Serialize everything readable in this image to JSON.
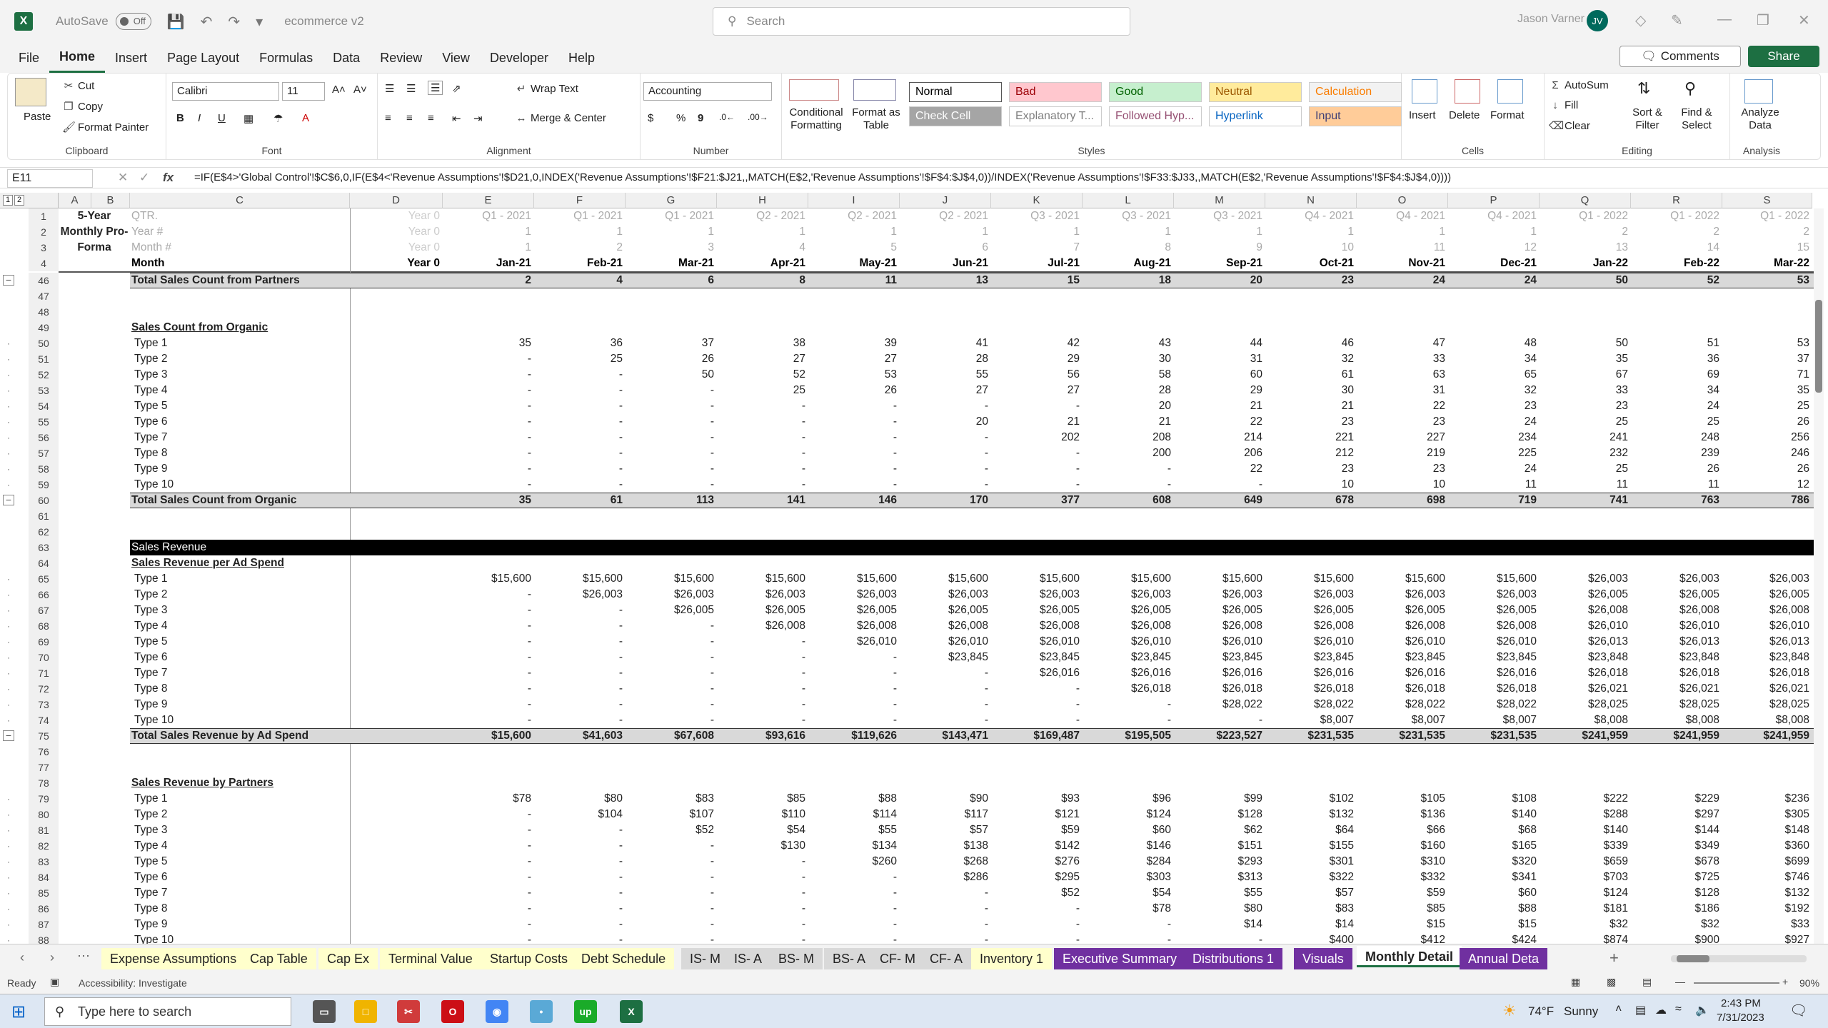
{
  "title_bar": {
    "autosave_label": "AutoSave",
    "autosave_state": "Off",
    "file_name": "ecommerce v2",
    "search_placeholder": "Search",
    "user_name": "Jason Varner",
    "user_initials": "JV"
  },
  "menu": [
    "File",
    "Home",
    "Insert",
    "Page Layout",
    "Formulas",
    "Data",
    "Review",
    "View",
    "Developer",
    "Help"
  ],
  "menu_buttons": {
    "comments": "Comments",
    "share": "Share"
  },
  "ribbon": {
    "clipboard": {
      "paste": "Paste",
      "cut": "Cut",
      "copy": "Copy",
      "format_painter": "Format Painter",
      "label": "Clipboard"
    },
    "font": {
      "name": "Calibri",
      "size": "11",
      "label": "Font"
    },
    "alignment": {
      "wrap_text": "Wrap Text",
      "merge_center": "Merge & Center",
      "label": "Alignment"
    },
    "number": {
      "format": "Accounting",
      "currency": "$",
      "percent": "%",
      "comma": "9",
      "label": "Number"
    },
    "styles": {
      "conditional": "Conditional Formatting",
      "format_table": "Format as Table",
      "label": "Styles",
      "cells": [
        {
          "name": "Normal",
          "bg": "#ffffff",
          "fg": "#000000"
        },
        {
          "name": "Bad",
          "bg": "#ffc7ce",
          "fg": "#9c0006"
        },
        {
          "name": "Good",
          "bg": "#c6efce",
          "fg": "#006100"
        },
        {
          "name": "Neutral",
          "bg": "#ffeb9c",
          "fg": "#9c5700"
        },
        {
          "name": "Calculation",
          "bg": "#f2f2f2",
          "fg": "#fa7d00"
        },
        {
          "name": "Check Cell",
          "bg": "#a5a5a5",
          "fg": "#ffffff"
        },
        {
          "name": "Explanatory T...",
          "bg": "#ffffff",
          "fg": "#7f7f7f"
        },
        {
          "name": "Followed Hyp...",
          "bg": "#ffffff",
          "fg": "#954f72"
        },
        {
          "name": "Hyperlink",
          "bg": "#ffffff",
          "fg": "#0563c1"
        },
        {
          "name": "Input",
          "bg": "#ffcc99",
          "fg": "#3f3f76"
        }
      ]
    },
    "cells": {
      "insert": "Insert",
      "delete": "Delete",
      "format": "Format",
      "label": "Cells"
    },
    "editing": {
      "autosum": "AutoSum",
      "fill": "Fill",
      "clear": "Clear",
      "sort_filter": "Sort & Filter",
      "find_select": "Find & Select",
      "label": "Editing"
    },
    "analysis": {
      "analyze": "Analyze Data",
      "label": "Analysis"
    }
  },
  "formula_bar": {
    "name_box": "E11",
    "fx": "fx",
    "formula": "=IF(E$4>'Global Control'!$C$6,0,IF(E$4<'Revenue Assumptions'!$D21,0,INDEX('Revenue Assumptions'!$F21:$J21,,MATCH(E$2,'Revenue Assumptions'!$F$4:$J$4,0))/INDEX('Revenue Assumptions'!$F33:$J33,,MATCH(E$2,'Revenue Assumptions'!$F$4:$J$4,0))))"
  },
  "columns": [
    "A",
    "B",
    "C",
    "D",
    "E",
    "F",
    "G",
    "H",
    "I",
    "J",
    "K",
    "L",
    "M",
    "N",
    "O",
    "P",
    "Q",
    "R",
    "S"
  ],
  "header_rows": {
    "r1_label": "5-Year",
    "r2_label": "Monthly Pro-",
    "r3_label": "Forma",
    "qtr_label": "QTR.",
    "year_label": "Year #",
    "month_num_label": "Month #",
    "month_label": "Month",
    "qtr": [
      "Year 0",
      "Q1 - 2021",
      "Q1 - 2021",
      "Q1 - 2021",
      "Q2 - 2021",
      "Q2 - 2021",
      "Q2 - 2021",
      "Q3 - 2021",
      "Q3 - 2021",
      "Q3 - 2021",
      "Q4 - 2021",
      "Q4 - 2021",
      "Q4 - 2021",
      "Q1 - 2022",
      "Q1 - 2022",
      "Q1 - 2022"
    ],
    "year": [
      "Year 0",
      "1",
      "1",
      "1",
      "1",
      "1",
      "1",
      "1",
      "1",
      "1",
      "1",
      "1",
      "1",
      "2",
      "2",
      "2"
    ],
    "month_num": [
      "Year 0",
      "1",
      "2",
      "3",
      "4",
      "5",
      "6",
      "7",
      "8",
      "9",
      "10",
      "11",
      "12",
      "13",
      "14",
      "15"
    ],
    "month": [
      "Year 0",
      "Jan-21",
      "Feb-21",
      "Mar-21",
      "Apr-21",
      "May-21",
      "Jun-21",
      "Jul-21",
      "Aug-21",
      "Sep-21",
      "Oct-21",
      "Nov-21",
      "Dec-21",
      "Jan-22",
      "Feb-22",
      "Mar-22"
    ]
  },
  "rows": [
    {
      "n": "46",
      "label": "Total Sales Count from Partners",
      "type": "total",
      "v": [
        "",
        "2",
        "4",
        "6",
        "8",
        "11",
        "13",
        "15",
        "18",
        "20",
        "23",
        "24",
        "24",
        "50",
        "52",
        "53"
      ]
    },
    {
      "n": "47",
      "label": "",
      "type": "blank",
      "v": []
    },
    {
      "n": "48",
      "label": "",
      "type": "blank",
      "v": []
    },
    {
      "n": "49",
      "label": "Sales Count from Organic",
      "type": "section",
      "v": []
    },
    {
      "n": "50",
      "label": "Type 1",
      "type": "data",
      "v": [
        "",
        "35",
        "36",
        "37",
        "38",
        "39",
        "41",
        "42",
        "43",
        "44",
        "46",
        "47",
        "48",
        "50",
        "51",
        "53"
      ]
    },
    {
      "n": "51",
      "label": "Type 2",
      "type": "data",
      "v": [
        "",
        "-",
        "25",
        "26",
        "27",
        "27",
        "28",
        "29",
        "30",
        "31",
        "32",
        "33",
        "34",
        "35",
        "36",
        "37"
      ]
    },
    {
      "n": "52",
      "label": "Type 3",
      "type": "data",
      "v": [
        "",
        "-",
        "-",
        "50",
        "52",
        "53",
        "55",
        "56",
        "58",
        "60",
        "61",
        "63",
        "65",
        "67",
        "69",
        "71"
      ]
    },
    {
      "n": "53",
      "label": "Type 4",
      "type": "data",
      "v": [
        "",
        "-",
        "-",
        "-",
        "25",
        "26",
        "27",
        "27",
        "28",
        "29",
        "30",
        "31",
        "32",
        "33",
        "34",
        "35"
      ]
    },
    {
      "n": "54",
      "label": "Type 5",
      "type": "data",
      "v": [
        "",
        "-",
        "-",
        "-",
        "-",
        "-",
        "-",
        "-",
        "20",
        "21",
        "21",
        "22",
        "23",
        "23",
        "24",
        "25"
      ]
    },
    {
      "n": "55",
      "label": "Type 6",
      "type": "data",
      "v": [
        "",
        "-",
        "-",
        "-",
        "-",
        "-",
        "20",
        "21",
        "21",
        "22",
        "23",
        "23",
        "24",
        "25",
        "25",
        "26"
      ]
    },
    {
      "n": "56",
      "label": "Type 7",
      "type": "data",
      "v": [
        "",
        "-",
        "-",
        "-",
        "-",
        "-",
        "-",
        "202",
        "208",
        "214",
        "221",
        "227",
        "234",
        "241",
        "248",
        "256"
      ]
    },
    {
      "n": "57",
      "label": "Type 8",
      "type": "data",
      "v": [
        "",
        "-",
        "-",
        "-",
        "-",
        "-",
        "-",
        "-",
        "200",
        "206",
        "212",
        "219",
        "225",
        "232",
        "239",
        "246"
      ]
    },
    {
      "n": "58",
      "label": "Type 9",
      "type": "data",
      "v": [
        "",
        "-",
        "-",
        "-",
        "-",
        "-",
        "-",
        "-",
        "-",
        "22",
        "23",
        "23",
        "24",
        "25",
        "26",
        "26"
      ]
    },
    {
      "n": "59",
      "label": "Type 10",
      "type": "data",
      "v": [
        "",
        "-",
        "-",
        "-",
        "-",
        "-",
        "-",
        "-",
        "-",
        "-",
        "10",
        "10",
        "11",
        "11",
        "11",
        "12"
      ]
    },
    {
      "n": "60",
      "label": "Total Sales Count from Organic",
      "type": "total",
      "v": [
        "",
        "35",
        "61",
        "113",
        "141",
        "146",
        "170",
        "377",
        "608",
        "649",
        "678",
        "698",
        "719",
        "741",
        "763",
        "786"
      ]
    },
    {
      "n": "61",
      "label": "",
      "type": "blank",
      "v": []
    },
    {
      "n": "62",
      "label": "",
      "type": "blank",
      "v": []
    },
    {
      "n": "63",
      "label": "Sales Revenue",
      "type": "banner",
      "v": []
    },
    {
      "n": "64",
      "label": "Sales Revenue per Ad Spend",
      "type": "section",
      "v": []
    },
    {
      "n": "65",
      "label": "Type 1",
      "type": "data",
      "v": [
        "",
        "$15,600",
        "$15,600",
        "$15,600",
        "$15,600",
        "$15,600",
        "$15,600",
        "$15,600",
        "$15,600",
        "$15,600",
        "$15,600",
        "$15,600",
        "$15,600",
        "$26,003",
        "$26,003",
        "$26,003"
      ]
    },
    {
      "n": "66",
      "label": "Type 2",
      "type": "data",
      "v": [
        "",
        "-",
        "$26,003",
        "$26,003",
        "$26,003",
        "$26,003",
        "$26,003",
        "$26,003",
        "$26,003",
        "$26,003",
        "$26,003",
        "$26,003",
        "$26,003",
        "$26,005",
        "$26,005",
        "$26,005"
      ]
    },
    {
      "n": "67",
      "label": "Type 3",
      "type": "data",
      "v": [
        "",
        "-",
        "-",
        "$26,005",
        "$26,005",
        "$26,005",
        "$26,005",
        "$26,005",
        "$26,005",
        "$26,005",
        "$26,005",
        "$26,005",
        "$26,005",
        "$26,008",
        "$26,008",
        "$26,008"
      ]
    },
    {
      "n": "68",
      "label": "Type 4",
      "type": "data",
      "v": [
        "",
        "-",
        "-",
        "-",
        "$26,008",
        "$26,008",
        "$26,008",
        "$26,008",
        "$26,008",
        "$26,008",
        "$26,008",
        "$26,008",
        "$26,008",
        "$26,010",
        "$26,010",
        "$26,010"
      ]
    },
    {
      "n": "69",
      "label": "Type 5",
      "type": "data",
      "v": [
        "",
        "-",
        "-",
        "-",
        "-",
        "$26,010",
        "$26,010",
        "$26,010",
        "$26,010",
        "$26,010",
        "$26,010",
        "$26,010",
        "$26,010",
        "$26,013",
        "$26,013",
        "$26,013"
      ]
    },
    {
      "n": "70",
      "label": "Type 6",
      "type": "data",
      "v": [
        "",
        "-",
        "-",
        "-",
        "-",
        "-",
        "$23,845",
        "$23,845",
        "$23,845",
        "$23,845",
        "$23,845",
        "$23,845",
        "$23,845",
        "$23,848",
        "$23,848",
        "$23,848"
      ]
    },
    {
      "n": "71",
      "label": "Type 7",
      "type": "data",
      "v": [
        "",
        "-",
        "-",
        "-",
        "-",
        "-",
        "-",
        "$26,016",
        "$26,016",
        "$26,016",
        "$26,016",
        "$26,016",
        "$26,016",
        "$26,018",
        "$26,018",
        "$26,018"
      ]
    },
    {
      "n": "72",
      "label": "Type 8",
      "type": "data",
      "v": [
        "",
        "-",
        "-",
        "-",
        "-",
        "-",
        "-",
        "-",
        "$26,018",
        "$26,018",
        "$26,018",
        "$26,018",
        "$26,018",
        "$26,021",
        "$26,021",
        "$26,021"
      ]
    },
    {
      "n": "73",
      "label": "Type 9",
      "type": "data",
      "v": [
        "",
        "-",
        "-",
        "-",
        "-",
        "-",
        "-",
        "-",
        "-",
        "$28,022",
        "$28,022",
        "$28,022",
        "$28,022",
        "$28,025",
        "$28,025",
        "$28,025"
      ]
    },
    {
      "n": "74",
      "label": "Type 10",
      "type": "data",
      "v": [
        "",
        "-",
        "-",
        "-",
        "-",
        "-",
        "-",
        "-",
        "-",
        "-",
        "$8,007",
        "$8,007",
        "$8,007",
        "$8,008",
        "$8,008",
        "$8,008"
      ]
    },
    {
      "n": "75",
      "label": "Total Sales Revenue by Ad Spend",
      "type": "total",
      "v": [
        "",
        "$15,600",
        "$41,603",
        "$67,608",
        "$93,616",
        "$119,626",
        "$143,471",
        "$169,487",
        "$195,505",
        "$223,527",
        "$231,535",
        "$231,535",
        "$231,535",
        "$241,959",
        "$241,959",
        "$241,959"
      ]
    },
    {
      "n": "76",
      "label": "",
      "type": "blank",
      "v": []
    },
    {
      "n": "77",
      "label": "",
      "type": "blank",
      "v": []
    },
    {
      "n": "78",
      "label": "Sales Revenue by Partners",
      "type": "section",
      "v": []
    },
    {
      "n": "79",
      "label": "Type 1",
      "type": "data",
      "v": [
        "",
        "$78",
        "$80",
        "$83",
        "$85",
        "$88",
        "$90",
        "$93",
        "$96",
        "$99",
        "$102",
        "$105",
        "$108",
        "$222",
        "$229",
        "$236"
      ]
    },
    {
      "n": "80",
      "label": "Type 2",
      "type": "data",
      "v": [
        "",
        "-",
        "$104",
        "$107",
        "$110",
        "$114",
        "$117",
        "$121",
        "$124",
        "$128",
        "$132",
        "$136",
        "$140",
        "$288",
        "$297",
        "$305"
      ]
    },
    {
      "n": "81",
      "label": "Type 3",
      "type": "data",
      "v": [
        "",
        "-",
        "-",
        "$52",
        "$54",
        "$55",
        "$57",
        "$59",
        "$60",
        "$62",
        "$64",
        "$66",
        "$68",
        "$140",
        "$144",
        "$148"
      ]
    },
    {
      "n": "82",
      "label": "Type 4",
      "type": "data",
      "v": [
        "",
        "-",
        "-",
        "-",
        "$130",
        "$134",
        "$138",
        "$142",
        "$146",
        "$151",
        "$155",
        "$160",
        "$165",
        "$339",
        "$349",
        "$360"
      ]
    },
    {
      "n": "83",
      "label": "Type 5",
      "type": "data",
      "v": [
        "",
        "-",
        "-",
        "-",
        "-",
        "$260",
        "$268",
        "$276",
        "$284",
        "$293",
        "$301",
        "$310",
        "$320",
        "$659",
        "$678",
        "$699"
      ]
    },
    {
      "n": "84",
      "label": "Type 6",
      "type": "data",
      "v": [
        "",
        "-",
        "-",
        "-",
        "-",
        "-",
        "$286",
        "$295",
        "$303",
        "$313",
        "$322",
        "$332",
        "$341",
        "$703",
        "$725",
        "$746"
      ]
    },
    {
      "n": "85",
      "label": "Type 7",
      "type": "data",
      "v": [
        "",
        "-",
        "-",
        "-",
        "-",
        "-",
        "-",
        "$52",
        "$54",
        "$55",
        "$57",
        "$59",
        "$60",
        "$124",
        "$128",
        "$132"
      ]
    },
    {
      "n": "86",
      "label": "Type 8",
      "type": "data",
      "v": [
        "",
        "-",
        "-",
        "-",
        "-",
        "-",
        "-",
        "-",
        "$78",
        "$80",
        "$83",
        "$85",
        "$88",
        "$181",
        "$186",
        "$192"
      ]
    },
    {
      "n": "87",
      "label": "Type 9",
      "type": "data",
      "v": [
        "",
        "-",
        "-",
        "-",
        "-",
        "-",
        "-",
        "-",
        "-",
        "$14",
        "$14",
        "$15",
        "$15",
        "$32",
        "$32",
        "$33"
      ]
    },
    {
      "n": "88",
      "label": "Type 10",
      "type": "data",
      "v": [
        "",
        "-",
        "-",
        "-",
        "-",
        "-",
        "-",
        "-",
        "-",
        "-",
        "$400",
        "$412",
        "$424",
        "$874",
        "$900",
        "$927"
      ]
    }
  ],
  "sheet_tabs": [
    {
      "name": "Expense Assumptions",
      "bg": "#ffffcc",
      "fg": "#222"
    },
    {
      "name": "Cap Table",
      "bg": "#ffffcc",
      "fg": "#222"
    },
    {
      "name": "Cap Ex",
      "bg": "#ffffcc",
      "fg": "#222"
    },
    {
      "name": "Terminal Value",
      "bg": "#ffffcc",
      "fg": "#222"
    },
    {
      "name": "Startup Costs",
      "bg": "#ffffcc",
      "fg": "#222"
    },
    {
      "name": "Debt Schedule",
      "bg": "#ffffcc",
      "fg": "#222"
    },
    {
      "name": "IS- M",
      "bg": "#d9d9d9",
      "fg": "#222"
    },
    {
      "name": "IS- A",
      "bg": "#d9d9d9",
      "fg": "#222"
    },
    {
      "name": "BS- M",
      "bg": "#d9d9d9",
      "fg": "#222"
    },
    {
      "name": "BS- A",
      "bg": "#d9d9d9",
      "fg": "#222"
    },
    {
      "name": "CF- M",
      "bg": "#d9d9d9",
      "fg": "#222"
    },
    {
      "name": "CF- A",
      "bg": "#d9d9d9",
      "fg": "#222"
    },
    {
      "name": "Inventory 1",
      "bg": "#ffffcc",
      "fg": "#222"
    },
    {
      "name": "Executive Summary",
      "bg": "#7030a0",
      "fg": "#ffffff"
    },
    {
      "name": "Distributions 1",
      "bg": "#7030a0",
      "fg": "#ffffff"
    },
    {
      "name": "Visuals",
      "bg": "#7030a0",
      "fg": "#ffffff"
    },
    {
      "name": "Monthly Detail",
      "bg": "#ffffff",
      "fg": "#222",
      "active": true
    },
    {
      "name": "Annual Deta",
      "bg": "#7030a0",
      "fg": "#ffffff"
    }
  ],
  "status": {
    "ready": "Ready",
    "accessibility": "Accessibility: Investigate",
    "zoom": "90%"
  },
  "taskbar": {
    "search_placeholder": "Type here to search",
    "temp": "74°F",
    "weather": "Sunny",
    "time": "2:43 PM",
    "date": "7/31/2023"
  }
}
